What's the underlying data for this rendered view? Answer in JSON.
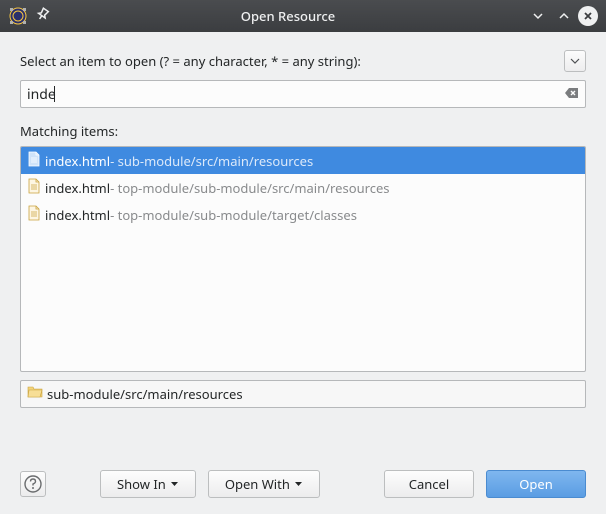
{
  "titlebar": {
    "title": "Open Resource"
  },
  "prompt": "Select an item to open (? = any character, * = any string):",
  "search": {
    "value": "inde"
  },
  "matching_label": "Matching items:",
  "results": [
    {
      "filename": "index.html",
      "path": "sub-module/src/main/resources",
      "selected": true
    },
    {
      "filename": "index.html",
      "path": "top-module/sub-module/src/main/resources",
      "selected": false
    },
    {
      "filename": "index.html",
      "path": "top-module/sub-module/target/classes",
      "selected": false
    }
  ],
  "selected_path": "sub-module/src/main/resources",
  "buttons": {
    "show_in": "Show In",
    "open_with": "Open With",
    "cancel": "Cancel",
    "open": "Open"
  }
}
